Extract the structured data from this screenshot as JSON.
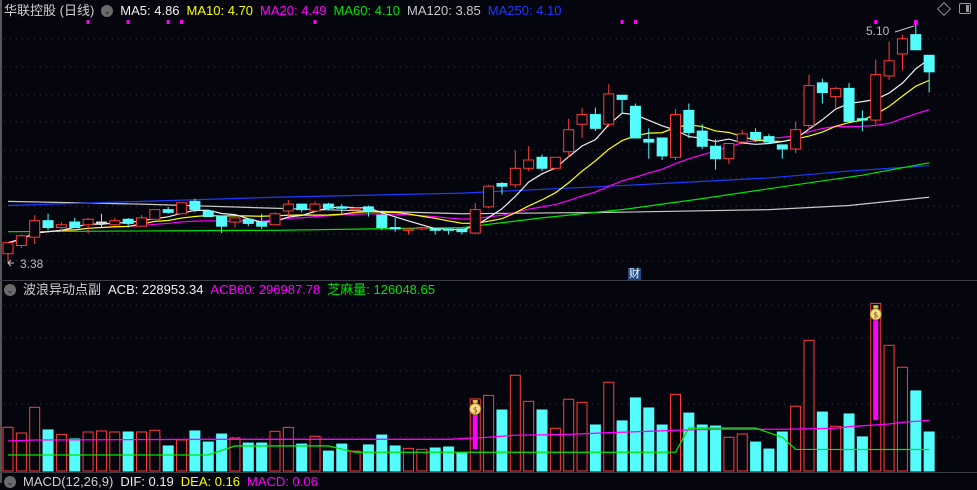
{
  "header": {
    "title": "华联控股 (日线)",
    "ma": [
      {
        "text": "MA5: 4.86",
        "color": "#f0f0f0"
      },
      {
        "text": "MA10: 4.70",
        "color": "#ffff00"
      },
      {
        "text": "MA20: 4.49",
        "color": "#ff00ff"
      },
      {
        "text": "MA60: 4.10",
        "color": "#00e600"
      },
      {
        "text": "MA120: 3.85",
        "color": "#c8c8c8"
      },
      {
        "text": "MA250: 4.10",
        "color": "#1a3cff"
      }
    ]
  },
  "volume_header": {
    "title": "波浪异动点副",
    "acb": "ACB: 228953.34",
    "acb60": "ACB60: 296987.78",
    "zhima": "芝麻量: 126048.65"
  },
  "macd_header": {
    "title": "MACD(12,26,9)",
    "dif": "DIF: 0.19",
    "dea": "DEA: 0.16",
    "macd": "MACD: 0.06"
  },
  "colors": {
    "up": "#ff3c3c",
    "down": "#54fcfc",
    "flat": "#d8d8d8",
    "background": "#05050d"
  },
  "chart_data": {
    "type": "candlestick",
    "price_range": [
      3.38,
      5.1
    ],
    "annotations": {
      "high_label": "5.10",
      "low_label": "3.38",
      "event_label": "财",
      "high_index": 68,
      "low_index": 0,
      "event_index": 47
    },
    "event_marker_indices": [
      6,
      9,
      12,
      13,
      23,
      46,
      47,
      65,
      68
    ],
    "ohlc": [
      [
        3.44,
        3.52,
        3.52,
        3.38
      ],
      [
        3.5,
        3.57,
        3.58,
        3.48
      ],
      [
        3.56,
        3.68,
        3.72,
        3.51
      ],
      [
        3.68,
        3.63,
        3.73,
        3.61
      ],
      [
        3.63,
        3.65,
        3.67,
        3.6
      ],
      [
        3.67,
        3.63,
        3.7,
        3.63
      ],
      [
        3.65,
        3.69,
        3.7,
        3.59
      ],
      [
        3.67,
        3.67,
        3.73,
        3.63
      ],
      [
        3.65,
        3.68,
        3.7,
        3.64
      ],
      [
        3.69,
        3.66,
        3.7,
        3.63
      ],
      [
        3.64,
        3.7,
        3.72,
        3.64
      ],
      [
        3.69,
        3.76,
        3.76,
        3.69
      ],
      [
        3.76,
        3.74,
        3.78,
        3.73
      ],
      [
        3.73,
        3.81,
        3.81,
        3.73
      ],
      [
        3.82,
        3.76,
        3.84,
        3.74
      ],
      [
        3.75,
        3.71,
        3.76,
        3.71
      ],
      [
        3.71,
        3.64,
        3.71,
        3.59
      ],
      [
        3.67,
        3.7,
        3.7,
        3.63
      ],
      [
        3.69,
        3.66,
        3.69,
        3.64
      ],
      [
        3.67,
        3.64,
        3.73,
        3.62
      ],
      [
        3.65,
        3.73,
        3.74,
        3.65
      ],
      [
        3.75,
        3.8,
        3.83,
        3.71
      ],
      [
        3.8,
        3.76,
        3.8,
        3.74
      ],
      [
        3.75,
        3.8,
        3.82,
        3.74
      ],
      [
        3.8,
        3.77,
        3.81,
        3.76
      ],
      [
        3.78,
        3.77,
        3.8,
        3.73
      ],
      [
        3.76,
        3.77,
        3.78,
        3.73
      ],
      [
        3.78,
        3.75,
        3.79,
        3.71
      ],
      [
        3.72,
        3.63,
        3.73,
        3.61
      ],
      [
        3.63,
        3.62,
        3.7,
        3.6
      ],
      [
        3.61,
        3.62,
        3.62,
        3.58
      ],
      [
        3.62,
        3.63,
        3.63,
        3.61
      ],
      [
        3.62,
        3.61,
        3.62,
        3.58
      ],
      [
        3.62,
        3.61,
        3.62,
        3.58
      ],
      [
        3.62,
        3.6,
        3.62,
        3.58
      ],
      [
        3.59,
        3.76,
        3.81,
        3.58
      ],
      [
        3.78,
        3.93,
        3.94,
        3.77
      ],
      [
        3.95,
        3.93,
        3.96,
        3.87
      ],
      [
        3.94,
        4.06,
        4.19,
        3.92
      ],
      [
        4.06,
        4.12,
        4.22,
        4.04
      ],
      [
        4.14,
        4.06,
        4.16,
        4.04
      ],
      [
        4.06,
        4.14,
        4.14,
        4.05
      ],
      [
        4.18,
        4.34,
        4.42,
        4.14
      ],
      [
        4.38,
        4.45,
        4.5,
        4.28
      ],
      [
        4.45,
        4.35,
        4.5,
        4.33
      ],
      [
        4.38,
        4.6,
        4.67,
        4.36
      ],
      [
        4.59,
        4.56,
        4.59,
        4.46
      ],
      [
        4.51,
        4.28,
        4.53,
        4.28
      ],
      [
        4.27,
        4.25,
        4.35,
        4.13
      ],
      [
        4.28,
        4.15,
        4.28,
        4.12
      ],
      [
        4.14,
        4.45,
        4.49,
        4.12
      ],
      [
        4.48,
        4.32,
        4.53,
        4.28
      ],
      [
        4.33,
        4.22,
        4.38,
        4.2
      ],
      [
        4.22,
        4.13,
        4.27,
        4.05
      ],
      [
        4.13,
        4.24,
        4.24,
        4.09
      ],
      [
        4.25,
        4.31,
        4.34,
        4.25
      ],
      [
        4.32,
        4.27,
        4.35,
        4.25
      ],
      [
        4.29,
        4.25,
        4.31,
        4.24
      ],
      [
        4.23,
        4.2,
        4.23,
        4.13
      ],
      [
        4.2,
        4.34,
        4.4,
        4.17
      ],
      [
        4.37,
        4.66,
        4.74,
        4.34
      ],
      [
        4.68,
        4.61,
        4.71,
        4.53
      ],
      [
        4.58,
        4.64,
        4.65,
        4.49
      ],
      [
        4.64,
        4.4,
        4.68,
        4.4
      ],
      [
        4.42,
        4.41,
        4.48,
        4.33
      ],
      [
        4.41,
        4.74,
        4.85,
        4.38
      ],
      [
        4.73,
        4.84,
        4.98,
        4.7
      ],
      [
        4.89,
        5.0,
        5.03,
        4.77
      ],
      [
        5.03,
        4.92,
        5.1,
        4.92
      ],
      [
        4.88,
        4.76,
        4.88,
        4.61
      ]
    ],
    "ma_long": {
      "ma60": [
        [
          0,
          3.6
        ],
        [
          20,
          3.61
        ],
        [
          34,
          3.63
        ],
        [
          40,
          3.7
        ],
        [
          46,
          3.76
        ],
        [
          52,
          3.84
        ],
        [
          59,
          3.94
        ],
        [
          64,
          4.01
        ],
        [
          69,
          4.1
        ]
      ],
      "ma120": [
        [
          0,
          3.82
        ],
        [
          10,
          3.8
        ],
        [
          20,
          3.77
        ],
        [
          34,
          3.73
        ],
        [
          45,
          3.74
        ],
        [
          57,
          3.76
        ],
        [
          63,
          3.79
        ],
        [
          69,
          3.85
        ]
      ],
      "ma250": [
        [
          0,
          3.79
        ],
        [
          10,
          3.82
        ],
        [
          20,
          3.85
        ],
        [
          34,
          3.88
        ],
        [
          45,
          3.93
        ],
        [
          57,
          3.99
        ],
        [
          63,
          4.04
        ],
        [
          69,
          4.08
        ]
      ]
    },
    "volume": [
      256500,
      223000,
      374000,
      241000,
      215000,
      188000,
      229000,
      235000,
      229000,
      229000,
      229000,
      239000,
      147000,
      182000,
      235000,
      170000,
      217000,
      194000,
      164000,
      164000,
      233000,
      256000,
      158000,
      204000,
      117000,
      158000,
      117000,
      153000,
      211000,
      147000,
      133000,
      127000,
      135000,
      141000,
      106000,
      423000,
      444000,
      358000,
      562000,
      409000,
      358000,
      251000,
      421000,
      403000,
      270000,
      521000,
      294000,
      429000,
      370000,
      270000,
      450000,
      340000,
      270000,
      264000,
      198000,
      217000,
      170000,
      129000,
      229000,
      380000,
      767000,
      346000,
      262000,
      335000,
      200000,
      984000,
      738000,
      609000,
      470000,
      228953
    ],
    "acb60_line": [
      [
        0,
        176000
      ],
      [
        2,
        182000
      ],
      [
        15,
        186000
      ],
      [
        33,
        186000
      ],
      [
        36,
        198000
      ],
      [
        38,
        210000
      ],
      [
        42,
        215000
      ],
      [
        45,
        225000
      ],
      [
        48,
        233000
      ],
      [
        50,
        239000
      ],
      [
        53,
        245000
      ],
      [
        58,
        245000
      ],
      [
        62,
        251000
      ],
      [
        63,
        260000
      ],
      [
        66,
        276000
      ],
      [
        67,
        286000
      ],
      [
        69,
        296988
      ]
    ],
    "zhima_line": [
      [
        0,
        94000
      ],
      [
        15,
        94000
      ],
      [
        17,
        147000
      ],
      [
        24,
        147000
      ],
      [
        26,
        110000
      ],
      [
        50,
        110000
      ],
      [
        51,
        252000
      ],
      [
        56,
        252000
      ],
      [
        58,
        198000
      ],
      [
        59,
        127000
      ],
      [
        69,
        126049
      ]
    ],
    "signal_bars": [
      {
        "index": 35,
        "from": 129000,
        "to": 329000
      },
      {
        "index": 65,
        "from": 299000,
        "to": 885000
      }
    ]
  }
}
